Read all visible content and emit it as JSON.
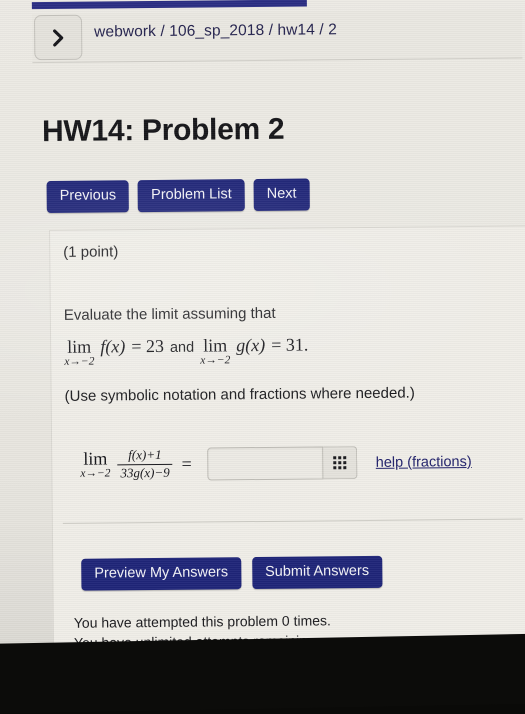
{
  "breadcrumb": {
    "back_icon": "chevron-right-icon",
    "path": "webwork / 106_sp_2018 / hw14 / 2"
  },
  "page_title": "HW14: Problem 2",
  "nav_buttons": [
    {
      "label": "Previous"
    },
    {
      "label": "Problem List"
    },
    {
      "label": "Next"
    }
  ],
  "problem": {
    "points": "(1 point)",
    "prompt": "Evaluate the limit assuming that",
    "given": {
      "lim1_main": "lim",
      "lim1_sub": "x→−2",
      "lim1_fn": "f(x)",
      "lim1_eq": "= 23",
      "and": "and",
      "lim2_main": "lim",
      "lim2_sub": "x→−2",
      "lim2_fn": "g(x)",
      "lim2_eq": "= 31."
    },
    "note": "(Use symbolic notation and fractions where needed.)",
    "expression": {
      "lim_main": "lim",
      "lim_sub": "x→−2",
      "numerator": "f(x)+1",
      "denominator": "33g(x)−9",
      "equals": "="
    },
    "answer_field": {
      "value": "",
      "placeholder": ""
    },
    "keypad_icon": "grid-keypad-icon",
    "help_link": "help (fractions)"
  },
  "submit_buttons": [
    {
      "label": "Preview My Answers"
    },
    {
      "label": "Submit Answers"
    }
  ],
  "attempts": {
    "line1": "You have attempted this problem 0 times.",
    "line2": "You have unlimited attempts remaining."
  },
  "colors": {
    "navy_button": "#1f2578",
    "topbar": "#2a2d83",
    "link": "#21216b"
  }
}
